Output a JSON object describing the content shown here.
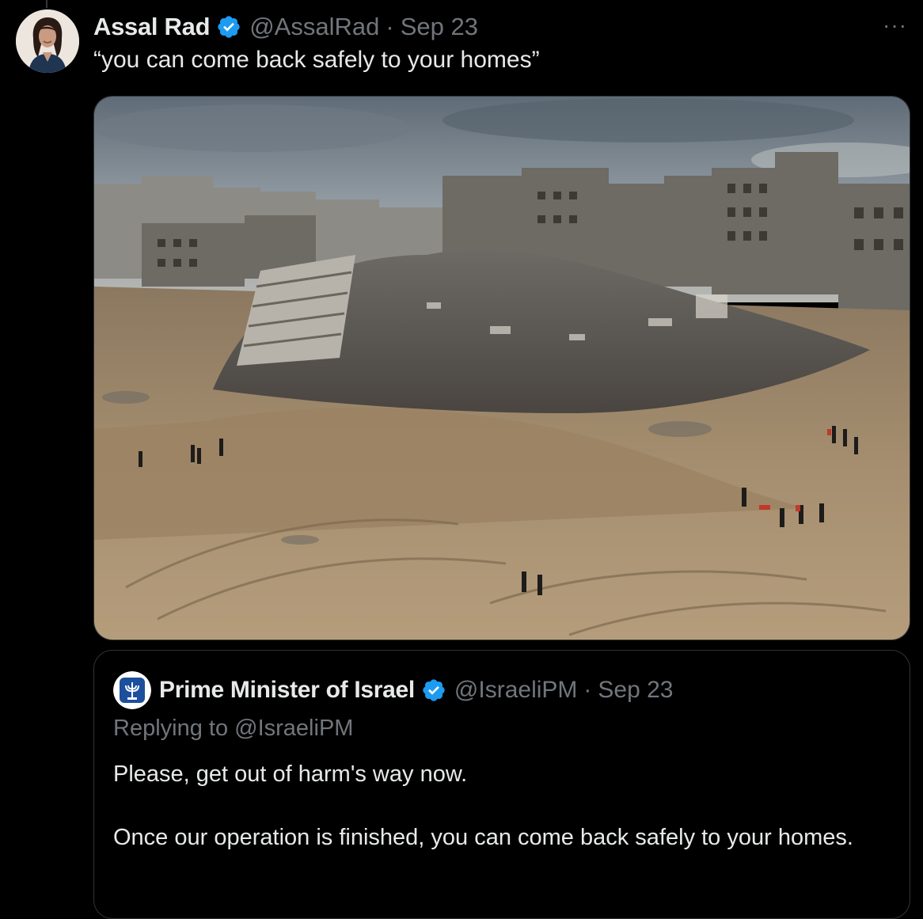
{
  "tweet": {
    "display_name": "Assal Rad",
    "handle": "@AssalRad",
    "separator": "·",
    "date": "Sep 23",
    "more_label": "···",
    "text": "“you can come back safely to your homes”",
    "avatar_icon": "user-avatar-woman",
    "verified_icon": "verified-badge-icon",
    "media_description_icon": "photo-destroyed-buildings"
  },
  "quote": {
    "display_name": "Prime Minister of Israel",
    "handle": "@IsraeliPM",
    "separator": "·",
    "date": "Sep 23",
    "replying_to": "Replying to @IsraeliPM",
    "paragraph_1": "Please, get out of harm's way now.",
    "paragraph_2": "Once our operation is finished, you can come back safely to your homes.",
    "avatar_icon": "state-emblem-avatar",
    "verified_icon": "verified-badge-icon"
  },
  "colors": {
    "background": "#000000",
    "text_primary": "#e7e9ea",
    "text_secondary": "#71767b",
    "border": "#2f3336",
    "verified_blue": "#1d9bf0"
  }
}
